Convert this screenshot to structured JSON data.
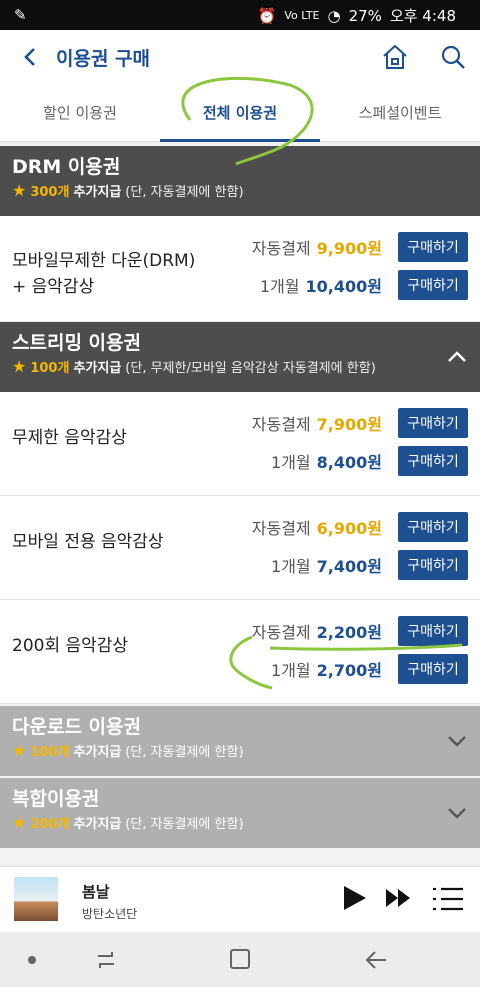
{
  "status": {
    "left_icon": "pill-icon",
    "battery": "27%",
    "time": "오후 4:48",
    "network": "Vo LTE"
  },
  "header": {
    "title": "이용권 구매"
  },
  "tabs": [
    "할인 이용권",
    "전체 이용권",
    "스페셜이벤트"
  ],
  "sections": {
    "drm": {
      "title": "DRM 이용권",
      "count": "300개",
      "bonus": "추가지급",
      "note": "(단, 자동결제에 한함)"
    },
    "stream": {
      "title": "스트리밍 이용권",
      "count": "100개",
      "bonus": "추가지급",
      "note": "(단, 무제한/모바일 음악감상 자동결제에 한함)"
    },
    "download": {
      "title": "다운로드 이용권",
      "count": "100개",
      "bonus": "추가지급",
      "note": "(단, 자동결제에 한함)"
    },
    "combo": {
      "title": "복합이용권",
      "count": "200개",
      "bonus": "추가지급",
      "note": "(단, 자동결제에 한함)"
    }
  },
  "items": [
    {
      "name1": "모바일무제한 다운(DRM)",
      "name2": "+ 음악감상",
      "auto_label": "자동결제",
      "auto_price": "9,900원",
      "month_label": "1개월",
      "month_price": "10,400원"
    },
    {
      "name1": "무제한 음악감상",
      "auto_label": "자동결제",
      "auto_price": "7,900원",
      "month_label": "1개월",
      "month_price": "8,400원"
    },
    {
      "name1": "모바일 전용 음악감상",
      "auto_label": "자동결제",
      "auto_price": "6,900원",
      "month_label": "1개월",
      "month_price": "7,400원"
    },
    {
      "name1": "200회 음악감상",
      "auto_label": "자동결제",
      "auto_price": "2,200원",
      "month_label": "1개월",
      "month_price": "2,700원"
    }
  ],
  "buy_label": "구매하기",
  "player": {
    "song": "봄날",
    "artist": "방탄소년단"
  },
  "colors": {
    "accent": "#1d4f91",
    "gold": "#e5a800",
    "section_dark": "#4d4d4d",
    "section_grey": "#b0b0b0",
    "scribble": "#8cc63f"
  }
}
